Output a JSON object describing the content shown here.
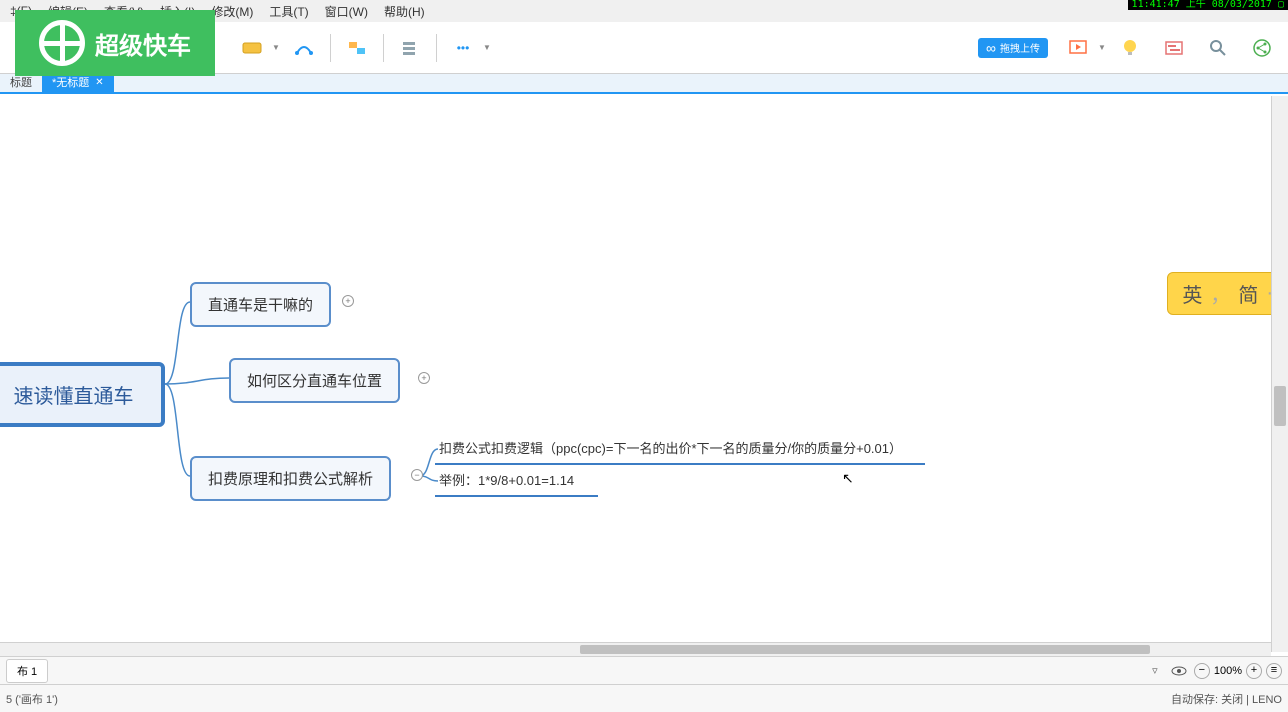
{
  "clock": "11:41:47 上午 08/03/2017 ▢",
  "menu": {
    "file": "‡(F)",
    "edit": "编辑(E)",
    "view": "查看(V)",
    "insert": "插入(I)",
    "modify": "修改(M)",
    "tools": "工具(T)",
    "window": "窗口(W)",
    "help": "帮助(H)"
  },
  "logo_text": "超级快车",
  "upload_badge": "拖拽上传",
  "tabs": {
    "inactive": "标题",
    "active": "*无标题",
    "close": "✕"
  },
  "mindmap": {
    "root": "速读懂直通车",
    "sub1": "直通车是干嘛的",
    "sub2": "如何区分直通车位置",
    "sub3": "扣费原理和扣费公式解析",
    "leaf1": "扣费公式扣费逻辑（ppc(cpc)=下一名的出价*下一名的质量分/你的质量分+0.01）",
    "leaf2": "举例：1*9/8+0.01=1.14",
    "expand": "+"
  },
  "ime": {
    "lang": "英",
    "sep": "，",
    "script": "简",
    "dot": "·"
  },
  "sheet": {
    "tab": "布 1",
    "zoom": "100%"
  },
  "status": {
    "left": "5 ('画布 1')",
    "right": "自动保存: 关闭  |  LENO"
  }
}
